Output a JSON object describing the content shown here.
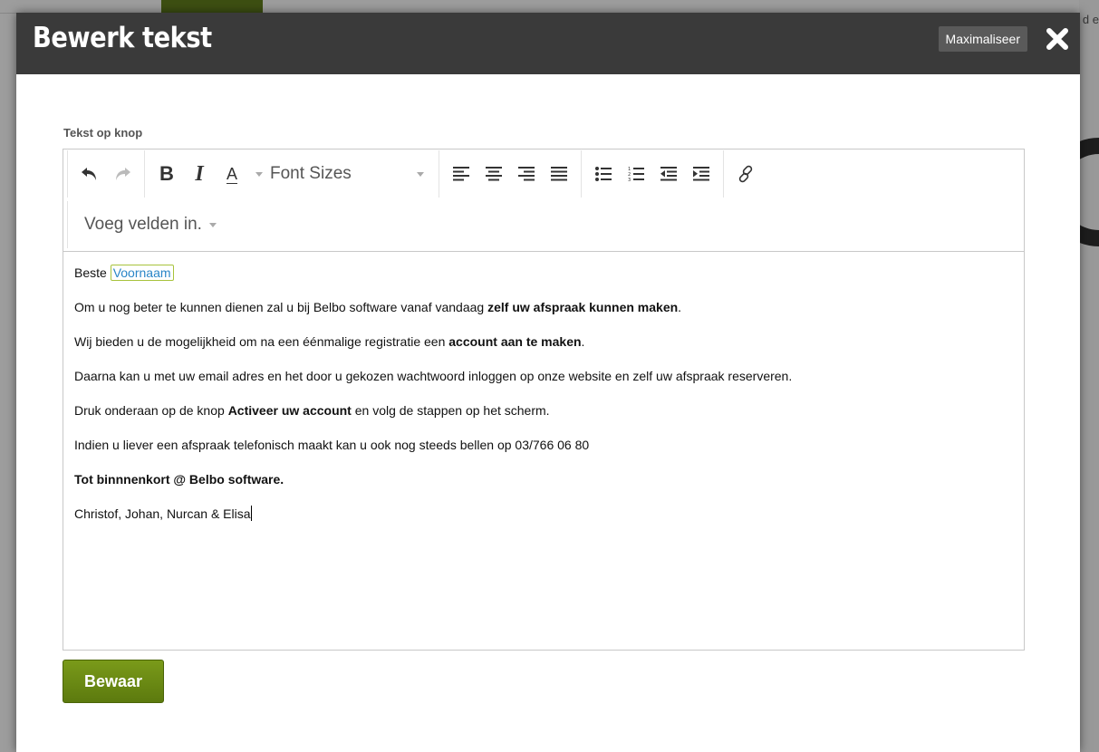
{
  "background": {
    "edge_text": "d e"
  },
  "dialog": {
    "title": "Bewerk tekst",
    "maximize_label": "Maximaliseer"
  },
  "field": {
    "label": "Tekst op knop"
  },
  "toolbar": {
    "font_sizes_label": "Font Sizes",
    "insert_fields_label": "Voeg velden in.",
    "icons": [
      "undo-icon",
      "redo-icon",
      "bold-icon",
      "italic-icon",
      "text-color-icon",
      "align-left-icon",
      "align-center-icon",
      "align-right-icon",
      "align-justify-icon",
      "bullet-list-icon",
      "numbered-list-icon",
      "outdent-icon",
      "indent-icon",
      "link-icon"
    ]
  },
  "content": {
    "greeting": "Beste",
    "merge_field": "Voornaam",
    "p1_text": "Om u nog beter te kunnen dienen zal u bij Belbo software vanaf vandaag ",
    "p1_bold": "zelf uw afspraak kunnen maken",
    "p1_end": ".",
    "p2_text": "Wij bieden u de mogelijkheid om na een éénmalige registratie een ",
    "p2_bold": "account aan te maken",
    "p2_end": ".",
    "p3": "Daarna kan u  met uw email adres en het door u gekozen wachtwoord inloggen op onze website en zelf uw afspraak reserveren.",
    "p4_text": "Druk onderaan op de knop ",
    "p4_bold": "Activeer uw account",
    "p4_end": " en volg de stappen op het scherm.",
    "p5": "Indien u liever een afspraak telefonisch maakt kan u ook nog steeds bellen op 03/766 06 80",
    "p6_bold": "Tot binnnenkort @ Belbo software.",
    "p7": "Christof, Johan, Nurcan & Elisa"
  },
  "actions": {
    "save_label": "Bewaar"
  },
  "colors": {
    "header": "#3a3a3a",
    "save_button": "#6b8c14",
    "merge_field_border": "#a8c33c",
    "merge_field_text": "#2a86c7"
  }
}
